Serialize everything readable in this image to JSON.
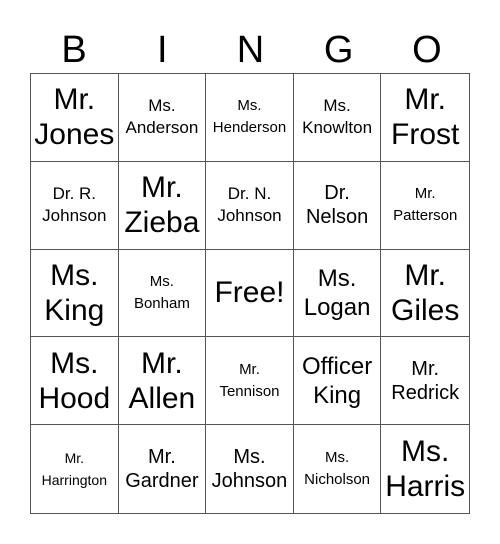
{
  "header": [
    "B",
    "I",
    "N",
    "G",
    "O"
  ],
  "cells": [
    {
      "line1": "Mr.",
      "line2": "Jones",
      "size": "xl"
    },
    {
      "line1": "Ms.",
      "line2": "Anderson",
      "size": "s"
    },
    {
      "line1": "Ms.",
      "line2": "Henderson",
      "size": "xs"
    },
    {
      "line1": "Ms.",
      "line2": "Knowlton",
      "size": "s"
    },
    {
      "line1": "Mr.",
      "line2": "Frost",
      "size": "xl"
    },
    {
      "line1": "Dr. R.",
      "line2": "Johnson",
      "size": "s"
    },
    {
      "line1": "Mr.",
      "line2": "Zieba",
      "size": "xl"
    },
    {
      "line1": "Dr. N.",
      "line2": "Johnson",
      "size": "s"
    },
    {
      "line1": "Dr.",
      "line2": "Nelson",
      "size": "m"
    },
    {
      "line1": "Mr.",
      "line2": "Patterson",
      "size": "xs"
    },
    {
      "line1": "Ms.",
      "line2": "King",
      "size": "xl"
    },
    {
      "line1": "Ms.",
      "line2": "Bonham",
      "size": "xs"
    },
    {
      "line1": "Free!",
      "line2": "",
      "size": "xl"
    },
    {
      "line1": "Ms.",
      "line2": "Logan",
      "size": "l"
    },
    {
      "line1": "Mr.",
      "line2": "Giles",
      "size": "xl"
    },
    {
      "line1": "Ms.",
      "line2": "Hood",
      "size": "xl"
    },
    {
      "line1": "Mr.",
      "line2": "Allen",
      "size": "xl"
    },
    {
      "line1": "Mr.",
      "line2": "Tennison",
      "size": "xs"
    },
    {
      "line1": "Officer",
      "line2": "King",
      "size": "l"
    },
    {
      "line1": "Mr.",
      "line2": "Redrick",
      "size": "m"
    },
    {
      "line1": "Mr.",
      "line2": "Harrington",
      "size": "xxs"
    },
    {
      "line1": "Mr.",
      "line2": "Gardner",
      "size": "m"
    },
    {
      "line1": "Ms.",
      "line2": "Johnson",
      "size": "m"
    },
    {
      "line1": "Ms.",
      "line2": "Nicholson",
      "size": "xs"
    },
    {
      "line1": "Ms.",
      "line2": "Harris",
      "size": "xl"
    }
  ]
}
